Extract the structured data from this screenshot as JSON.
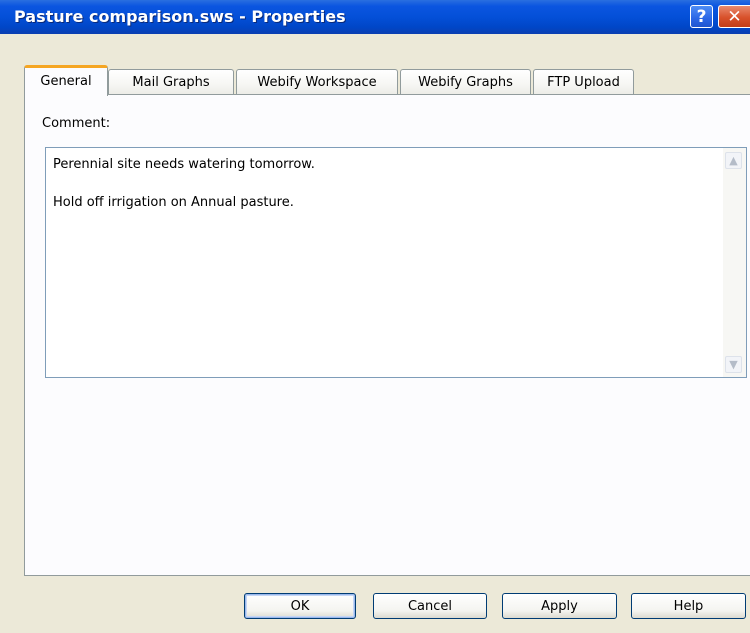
{
  "window": {
    "title": "Pasture comparison.sws - Properties",
    "help_glyph": "?",
    "close_glyph": "✕"
  },
  "tabs": [
    {
      "label": "General",
      "active": true
    },
    {
      "label": "Mail Graphs",
      "active": false
    },
    {
      "label": "Webify Workspace",
      "active": false
    },
    {
      "label": "Webify Graphs",
      "active": false
    },
    {
      "label": "FTP Upload",
      "active": false
    }
  ],
  "general": {
    "comment_label": "Comment:",
    "comment_value": "Perennial site needs watering tomorrow.\n\nHold off irrigation on Annual pasture."
  },
  "buttons": {
    "ok": "OK",
    "cancel": "Cancel",
    "apply": "Apply",
    "help": "Help"
  },
  "colors": {
    "titlebar": "#0450d8",
    "active_tab_accent": "#f5a623",
    "dialog_background": "#ece9d8"
  }
}
